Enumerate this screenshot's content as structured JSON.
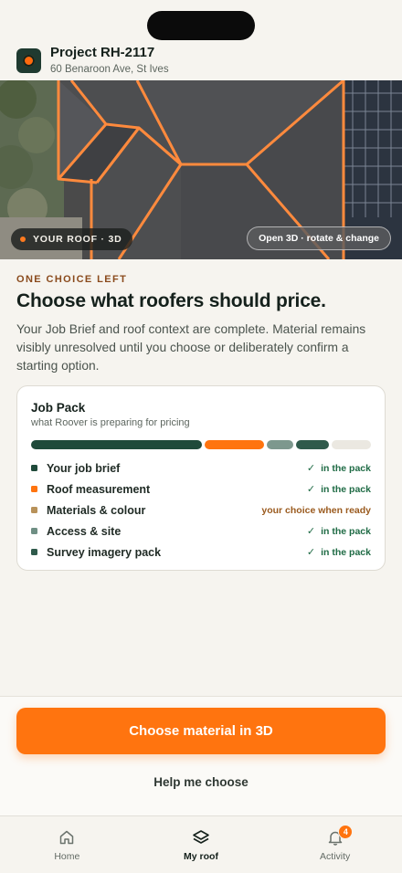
{
  "project": {
    "title": "Project RH-2117",
    "address": "60 Benaroon Ave, St Ives"
  },
  "roof_view": {
    "badge": "YOUR ROOF · 3D",
    "open_button": "Open 3D · rotate & change"
  },
  "intro": {
    "kicker": "ONE CHOICE LEFT",
    "headline": "Choose what roofers should price.",
    "body": "Your Job Brief and roof context are complete. Material remains visibly unresolved until you choose or deliberately confirm a starting option."
  },
  "job_pack": {
    "title": "Job Pack",
    "subtitle": "what Roover is preparing for pricing",
    "items": [
      {
        "label": "Your job brief",
        "status": "in the pack",
        "done": true,
        "color": "#1f4a3a"
      },
      {
        "label": "Roof measurement",
        "status": "in the pack",
        "done": true,
        "color": "#ff740f"
      },
      {
        "label": "Materials & colour",
        "status": "your choice when ready",
        "done": false,
        "color": "#b8925a"
      },
      {
        "label": "Access & site",
        "status": "in the pack",
        "done": true,
        "color": "#6f8f84"
      },
      {
        "label": "Survey imagery pack",
        "status": "in the pack",
        "done": true,
        "color": "#2f5a4b"
      }
    ],
    "progress": [
      {
        "share": 0.52,
        "color": "#1f4a3a"
      },
      {
        "share": 0.18,
        "color": "#ff740f"
      },
      {
        "share": 0.08,
        "color": "#7d988e"
      },
      {
        "share": 0.1,
        "color": "#2f5a4b"
      },
      {
        "share": 0.12,
        "color": "#ebe8e1"
      }
    ]
  },
  "actions": {
    "primary": "Choose material in 3D",
    "secondary": "Help me choose"
  },
  "tabs": [
    {
      "label": "Home",
      "icon": "home-icon"
    },
    {
      "label": "My roof",
      "icon": "layers-icon",
      "active": true
    },
    {
      "label": "Activity",
      "icon": "bell-icon",
      "badge": "4"
    }
  ],
  "colors": {
    "accent": "#ff740f",
    "brand_dark": "#1f4a3a",
    "check_green": "#1f6b45",
    "pending_text": "#9a5a1e"
  }
}
